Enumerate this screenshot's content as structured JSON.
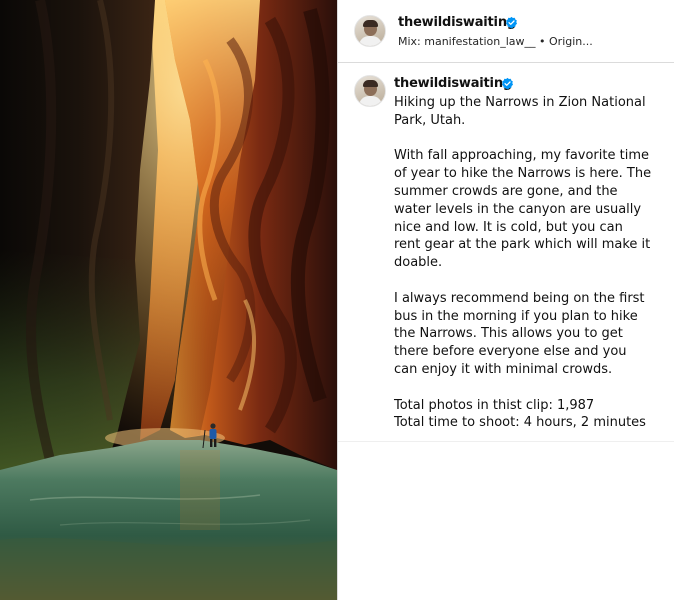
{
  "header": {
    "username": "thewildiswaiting",
    "verified": true,
    "audio_line": "Mix: manifestation_law__ • Origin..."
  },
  "caption": {
    "username": "thewildiswaiting",
    "verified": true,
    "paragraphs": [
      "Hiking up the Narrows in Zion National Park, Utah.",
      "With fall approaching, my favorite time of year to hike the Narrows is here. The summer crowds are gone, and the water levels in the canyon are usually nice and low. It is cold, but you can rent gear at the park which will make it doable.",
      "I always recommend being on the first bus in the morning if you plan to hike the Narrows. This allows you to get there before everyone else and you can enjoy it with minimal crowds.",
      "Total photos in thist clip: 1,987",
      "Total time to shoot: 4 hours, 2 minutes"
    ]
  },
  "colors": {
    "verified_badge": "#0095f6",
    "divider": "#dbdbdb",
    "canyon_glow": "#e8902a",
    "water": "#3f6b55"
  },
  "media": {
    "icon": "photo-canyon-narrows"
  }
}
